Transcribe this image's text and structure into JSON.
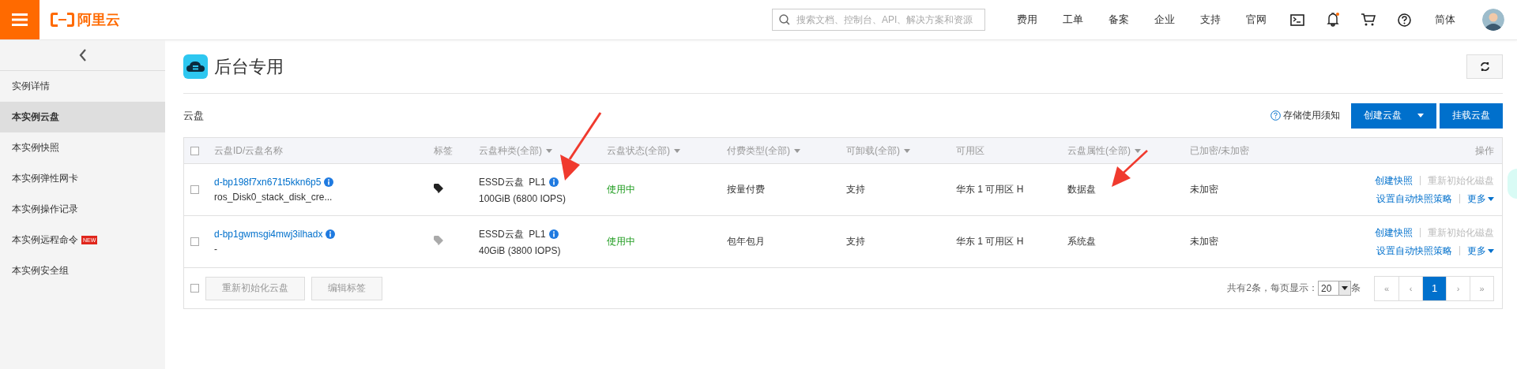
{
  "topbar": {
    "logo": "阿里云",
    "search": {
      "placeholder": "搜索文档、控制台、API、解决方案和资源"
    },
    "links": [
      "费用",
      "工单",
      "备案",
      "企业",
      "支持",
      "官网"
    ],
    "has_notification": true,
    "language": "简体"
  },
  "sidebar": {
    "items": [
      {
        "label": "实例详情",
        "selected": false
      },
      {
        "label": "本实例云盘",
        "selected": true
      },
      {
        "label": "本实例快照",
        "selected": false
      },
      {
        "label": "本实例弹性网卡",
        "selected": false
      },
      {
        "label": "本实例操作记录",
        "selected": false
      },
      {
        "label": "本实例远程命令",
        "selected": false,
        "badge": "NEW"
      },
      {
        "label": "本实例安全组",
        "selected": false
      }
    ]
  },
  "page": {
    "title": "后台专用",
    "section": "云盘",
    "help_link": "存储使用须知",
    "buttons": [
      {
        "label": "创建云盘",
        "kind": "split"
      },
      {
        "label": "挂载云盘",
        "kind": "plain"
      }
    ]
  },
  "table": {
    "select_all": {
      "checked": false
    },
    "columns": [
      {
        "label": "云盘ID/云盘名称",
        "filter": false
      },
      {
        "label": "标签",
        "filter": false
      },
      {
        "label": "云盘种类(全部)",
        "filter": true
      },
      {
        "label": "云盘状态(全部)",
        "filter": true
      },
      {
        "label": "付费类型(全部)",
        "filter": true
      },
      {
        "label": "可卸载(全部)",
        "filter": true
      },
      {
        "label": "可用区",
        "filter": false
      },
      {
        "label": "云盘属性(全部)",
        "filter": true
      },
      {
        "label": "已加密/未加密",
        "filter": false
      },
      {
        "label": "操作",
        "filter": false
      }
    ],
    "rows": [
      {
        "checked": false,
        "id": "d-bp198f7xn671t5kkn6p5",
        "name": "ros_Disk0_stack_disk_cre...",
        "tagged": true,
        "type": "ESSD云盘  PL1",
        "spec": "100GiB (6800 IOPS)",
        "status": "使用中",
        "billing": "按量付费",
        "detachable": "支持",
        "zone": "华东 1 可用区 H",
        "attribute": "数据盘",
        "encryption": "未加密",
        "actions": [
          {
            "label": "创建快照",
            "disabled": false
          },
          {
            "label": "重新初始化磁盘",
            "disabled": true
          },
          {
            "label": "设置自动快照策略",
            "disabled": false
          },
          {
            "label": "更多",
            "disabled": false
          }
        ]
      },
      {
        "checked": false,
        "id": "d-bp1gwmsgi4mwj3ilhadx",
        "name": "-",
        "tagged": false,
        "type": "ESSD云盘  PL1",
        "spec": "40GiB (3800 IOPS)",
        "status": "使用中",
        "billing": "包年包月",
        "detachable": "支持",
        "zone": "华东 1 可用区 H",
        "attribute": "系统盘",
        "encryption": "未加密",
        "actions": [
          {
            "label": "创建快照",
            "disabled": false
          },
          {
            "label": "重新初始化磁盘",
            "disabled": true
          },
          {
            "label": "设置自动快照策略",
            "disabled": false
          },
          {
            "label": "更多",
            "disabled": false
          }
        ]
      }
    ],
    "footer": {
      "checked": false,
      "buttons": [
        {
          "label": "重新初始化云盘",
          "disabled": true
        },
        {
          "label": "编辑标签",
          "disabled": true
        }
      ],
      "total": "共有2条，每页显示：",
      "page_size": "20",
      "unit": "条",
      "pages": [
        {
          "label": "«",
          "selected": false
        },
        {
          "label": "‹",
          "selected": false
        },
        {
          "label": "1",
          "selected": true
        },
        {
          "label": "›",
          "selected": false
        },
        {
          "label": "»",
          "selected": false
        }
      ]
    }
  }
}
